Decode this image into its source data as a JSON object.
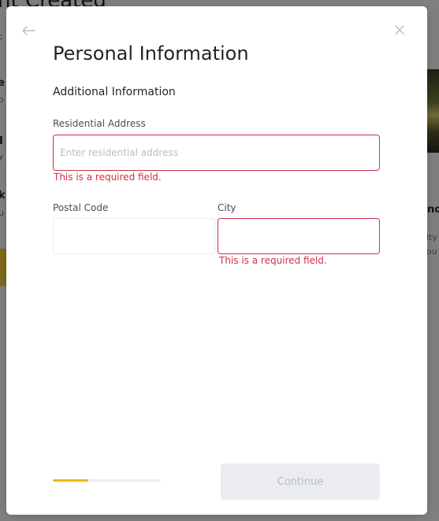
{
  "background": {
    "title": "nt Created",
    "row1": "e",
    "row1_sub": "c",
    "row2": "e",
    "row2_sub": "o",
    "row3": "I",
    "row3_sub": "y",
    "row4": "k",
    "row4_sub": "u",
    "right1": "no",
    "right2": "ity",
    "right3": "ou"
  },
  "modal": {
    "title": "Personal Information",
    "section_title": "Additional Information",
    "residential_address": {
      "label": "Residential Address",
      "placeholder": "Enter residential address",
      "value": "",
      "error": "This is a required field."
    },
    "postal_code": {
      "label": "Postal Code",
      "value": ""
    },
    "city": {
      "label": "City",
      "value": "",
      "error": "This is a required field."
    },
    "progress": {
      "fraction": 0.33
    },
    "continue_label": "Continue"
  },
  "icons": {
    "back": "arrow-left-icon",
    "close": "close-icon"
  },
  "colors": {
    "error": "#cf304a",
    "accent": "#f0b90b",
    "border": "#eaecef",
    "disabled_text": "#b7bdc6"
  }
}
